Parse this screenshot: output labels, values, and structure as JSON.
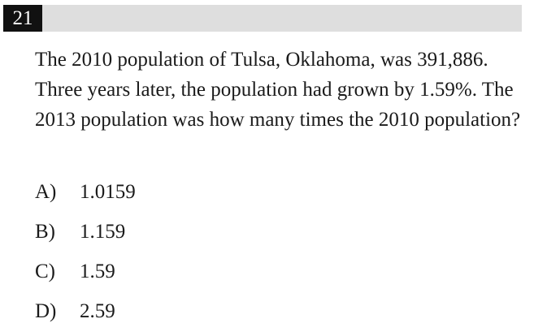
{
  "question": {
    "number": "21",
    "stem": "The 2010 population of Tulsa, Oklahoma, was 391,886. Three years later, the population had grown by 1.59%. The 2013 population was how many times the 2010 population?",
    "choices": [
      {
        "letter": "A)",
        "text": "1.0159"
      },
      {
        "letter": "B)",
        "text": "1.159"
      },
      {
        "letter": "C)",
        "text": "1.59"
      },
      {
        "letter": "D)",
        "text": "2.59"
      }
    ]
  },
  "colors": {
    "header_bar": "#dedede",
    "number_box": "#111111",
    "text": "#1a1a1a"
  }
}
